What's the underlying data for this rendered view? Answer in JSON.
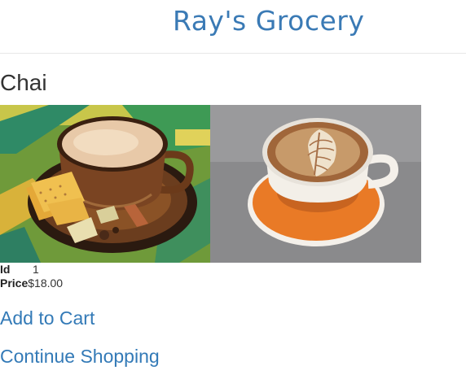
{
  "header": {
    "title": "Ray's Grocery"
  },
  "product": {
    "name": "Chai",
    "images": [
      {
        "name": "chai-tea-image",
        "alt": "Chai tea with biscuits"
      },
      {
        "name": "latte-image",
        "alt": "Latte with leaf latte art"
      }
    ],
    "id_label": "Id",
    "id_value": "1",
    "price_label": "Price",
    "price_value": "$18.00"
  },
  "actions": {
    "add_to_cart": "Add to Cart",
    "continue_shopping": "Continue Shopping"
  },
  "colors": {
    "link": "#337ab7",
    "title": "#3a7ab5"
  }
}
